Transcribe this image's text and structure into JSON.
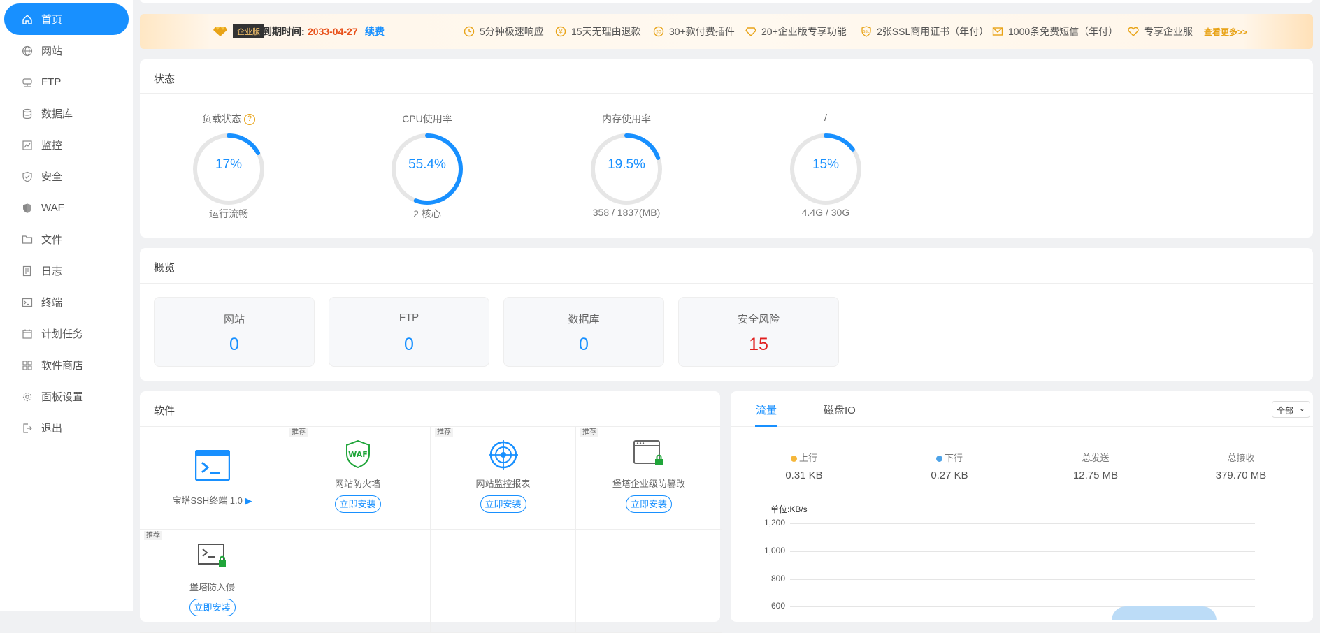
{
  "sidebar": {
    "items": [
      {
        "label": "首页",
        "icon": "home-icon",
        "active": true
      },
      {
        "label": "网站",
        "icon": "globe-icon"
      },
      {
        "label": "FTP",
        "icon": "ftp-icon"
      },
      {
        "label": "数据库",
        "icon": "database-icon"
      },
      {
        "label": "监控",
        "icon": "monitor-icon"
      },
      {
        "label": "安全",
        "icon": "shield-icon"
      },
      {
        "label": "WAF",
        "icon": "waf-icon"
      },
      {
        "label": "文件",
        "icon": "folder-icon"
      },
      {
        "label": "日志",
        "icon": "log-icon"
      },
      {
        "label": "终端",
        "icon": "terminal-icon"
      },
      {
        "label": "计划任务",
        "icon": "calendar-icon"
      },
      {
        "label": "软件商店",
        "icon": "grid-icon"
      },
      {
        "label": "面板设置",
        "icon": "gear-icon"
      },
      {
        "label": "退出",
        "icon": "logout-icon"
      }
    ]
  },
  "banner": {
    "edition_badge": "企业版",
    "expire_label": "到期时间:",
    "expire_date": "2033-04-27",
    "renew": "续费",
    "features": [
      "5分钟极速响应",
      "15天无理由退款",
      "30+款付费插件",
      "20+企业版专享功能",
      "2张SSL商用证书（年付）",
      "1000条免费短信（年付）",
      "专享企业服"
    ],
    "more": "查看更多>>"
  },
  "status": {
    "title": "状态",
    "gauges": [
      {
        "label": "负载状态",
        "value": "17%",
        "percent": 17,
        "sub": "运行流畅",
        "help": true
      },
      {
        "label": "CPU使用率",
        "value": "55.4%",
        "percent": 55.4,
        "sub": "2 核心"
      },
      {
        "label": "内存使用率",
        "value": "19.5%",
        "percent": 19.5,
        "sub": "358 / 1837(MB)"
      },
      {
        "label": "/",
        "value": "15%",
        "percent": 15,
        "sub": "4.4G / 30G"
      }
    ],
    "help_mark": "?"
  },
  "overview": {
    "title": "概览",
    "items": [
      {
        "label": "网站",
        "value": "0"
      },
      {
        "label": "FTP",
        "value": "0"
      },
      {
        "label": "数据库",
        "value": "0"
      },
      {
        "label": "安全风险",
        "value": "15"
      }
    ]
  },
  "software": {
    "title": "软件",
    "tag": "推荐",
    "install": "立即安装",
    "items": [
      {
        "name": "宝塔SSH终端 1.0",
        "icon": "terminal-app-icon"
      },
      {
        "name": "网站防火墙",
        "icon": "waf-shield-icon"
      },
      {
        "name": "网站监控报表",
        "icon": "monitor-target-icon"
      },
      {
        "name": "堡塔企业级防篡改",
        "icon": "tamper-proof-icon"
      },
      {
        "name": "堡塔防入侵",
        "icon": "intrusion-icon"
      }
    ]
  },
  "traffic": {
    "tabs": [
      "流量",
      "磁盘IO"
    ],
    "select": "全部",
    "stats": [
      {
        "label": "上行",
        "value": "0.31 KB",
        "color": "#f5b73b"
      },
      {
        "label": "下行",
        "value": "0.27 KB",
        "color": "#4ea3e8"
      },
      {
        "label": "总发送",
        "value": "12.75 MB"
      },
      {
        "label": "总接收",
        "value": "379.70 MB"
      }
    ]
  },
  "chart_data": {
    "type": "area",
    "ylabel": "单位:KB/s",
    "yticks": [
      "1,200",
      "1,000",
      "800",
      "600"
    ],
    "ylim": [
      600,
      1200
    ]
  }
}
